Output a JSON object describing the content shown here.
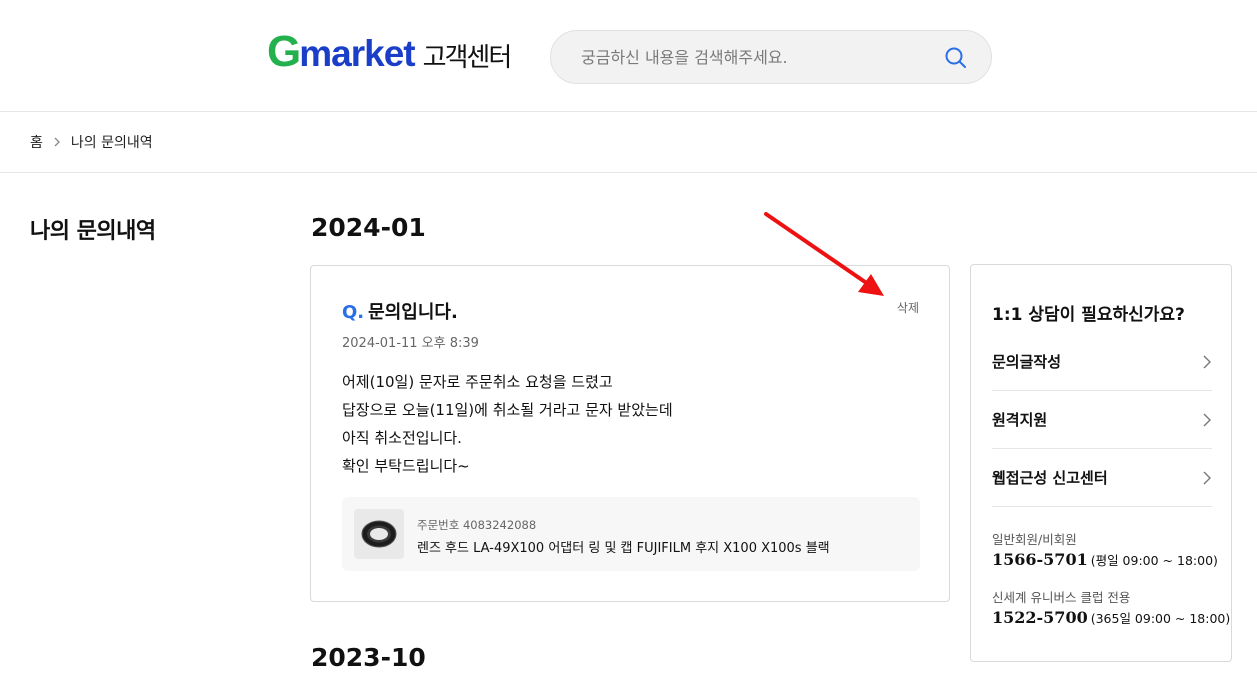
{
  "header": {
    "logo_g": "G",
    "logo_market": "market",
    "logo_sub": "고객센터",
    "search_placeholder": "궁금하신 내용을 검색해주세요."
  },
  "breadcrumb": {
    "home": "홈",
    "current": "나의 문의내역"
  },
  "sidebar": {
    "title": "나의 문의내역"
  },
  "months": [
    "2024-01",
    "2023-10"
  ],
  "inquiry": {
    "q_mark": "Q.",
    "title": "문의입니다.",
    "delete_label": "삭제",
    "date": "2024-01-11 오후 8:39",
    "body": [
      "어제(10일) 문자로 주문취소 요청을 드렸고",
      "답장으로 오늘(11일)에 취소될 거라고 문자 받았는데",
      "아직 취소전입니다.",
      "확인 부탁드립니다~"
    ],
    "order_no": "주문번호 4083242088",
    "product_name": "렌즈 후드 LA-49X100 어댑터 링 및 캡 FUJIFILM 후지 X100 X100s 블랙"
  },
  "help_panel": {
    "title": "1:1 상담이 필요하신가요?",
    "items": [
      {
        "label": "문의글작성"
      },
      {
        "label": "원격지원"
      },
      {
        "label": "웹접근성 신고센터"
      }
    ],
    "phones": [
      {
        "label": "일반회원/비회원",
        "number": "1566-5701",
        "hours": "(평일 09:00 ~ 18:00)"
      },
      {
        "label": "신세계 유니버스 클럽 전용",
        "number": "1522-5700",
        "hours": "(365일 09:00 ~ 18:00)"
      }
    ]
  },
  "colors": {
    "logo_green": "#23b14d",
    "logo_blue": "#1a3ec8",
    "q_blue": "#2a6ee8",
    "annotation_red": "#ee1111"
  }
}
